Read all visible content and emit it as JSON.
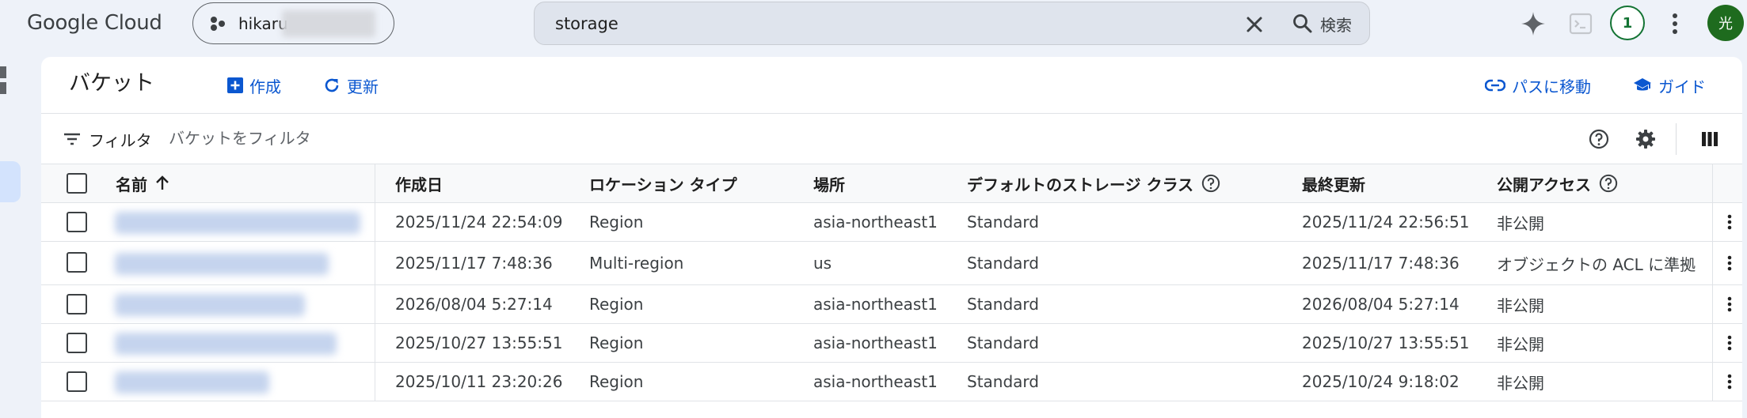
{
  "app": {
    "logo": "Google Cloud",
    "project_name": "hikaru"
  },
  "search": {
    "value": "storage",
    "button_label": "検索"
  },
  "top_icons": [
    "gemini-icon",
    "cloud-shell-icon",
    "notifications-badge",
    "more-vert-icon",
    "account-avatar"
  ],
  "notifications": {
    "count": "1"
  },
  "account": {
    "initial": "光"
  },
  "page": {
    "title": "バケット",
    "create_label": "作成",
    "refresh_label": "更新",
    "goto_path_label": "パスに移動",
    "guide_label": "ガイド"
  },
  "filter": {
    "label": "フィルタ",
    "placeholder": "バケットをフィルタ"
  },
  "table": {
    "headers": {
      "name": "名前",
      "created": "作成日",
      "location_type": "ロケーション タイプ",
      "location": "場所",
      "storage_class": "デフォルトのストレージ クラス",
      "updated": "最終更新",
      "public_access": "公開アクセス"
    },
    "sort": {
      "column": "name",
      "direction": "ascending"
    },
    "rows": [
      {
        "created": "2025/11/24 22:54:09",
        "location_type": "Region",
        "location": "asia-northeast1",
        "storage_class": "Standard",
        "updated": "2025/11/24 22:56:51",
        "public_access": "非公開"
      },
      {
        "created": "2025/11/17 7:48:36",
        "location_type": "Multi-region",
        "location": "us",
        "storage_class": "Standard",
        "updated": "2025/11/17 7:48:36",
        "public_access": "オブジェクトの ACL に準拠"
      },
      {
        "created": "2026/08/04 5:27:14",
        "location_type": "Region",
        "location": "asia-northeast1",
        "storage_class": "Standard",
        "updated": "2026/08/04 5:27:14",
        "public_access": "非公開"
      },
      {
        "created": "2025/10/27 13:55:51",
        "location_type": "Region",
        "location": "asia-northeast1",
        "storage_class": "Standard",
        "updated": "2025/10/27 13:55:51",
        "public_access": "非公開"
      },
      {
        "created": "2025/10/11 23:20:26",
        "location_type": "Region",
        "location": "asia-northeast1",
        "storage_class": "Standard",
        "updated": "2025/10/24 9:18:02",
        "public_access": "非公開"
      }
    ]
  },
  "colors": {
    "accent": "#0b57d0",
    "background": "#eef2f9",
    "surface": "#ffffff",
    "badge": "#137333",
    "avatar": "#1e6b1e"
  }
}
